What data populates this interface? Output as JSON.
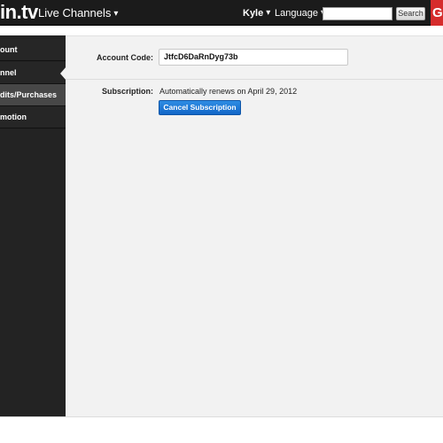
{
  "topbar": {
    "logo": "in.tv",
    "live_channels": "Live Channels",
    "caret": "▾",
    "user": "Kyle",
    "language": "Language",
    "search_placeholder": "",
    "search_button": "Search",
    "right_tab": "G"
  },
  "sidebar": {
    "items": [
      {
        "label": "ount"
      },
      {
        "label": "nnel"
      },
      {
        "label": "dits/Purchases"
      },
      {
        "label": "motion"
      }
    ]
  },
  "main": {
    "account_label": "Account Code:",
    "account_code": "JtfcD6DaRnDyg73b",
    "subscription_label": "Subscription:",
    "renew_text": "Automatically renews on April 29, 2012",
    "cancel_button": "Cancel Subscription"
  },
  "colors": {
    "topbar_bg": "#1b1b1b",
    "sidebar_bg": "#232323",
    "main_bg": "#f2f2f2",
    "accent_blue": "#1a73d6",
    "brand_red": "#d62c2c"
  }
}
